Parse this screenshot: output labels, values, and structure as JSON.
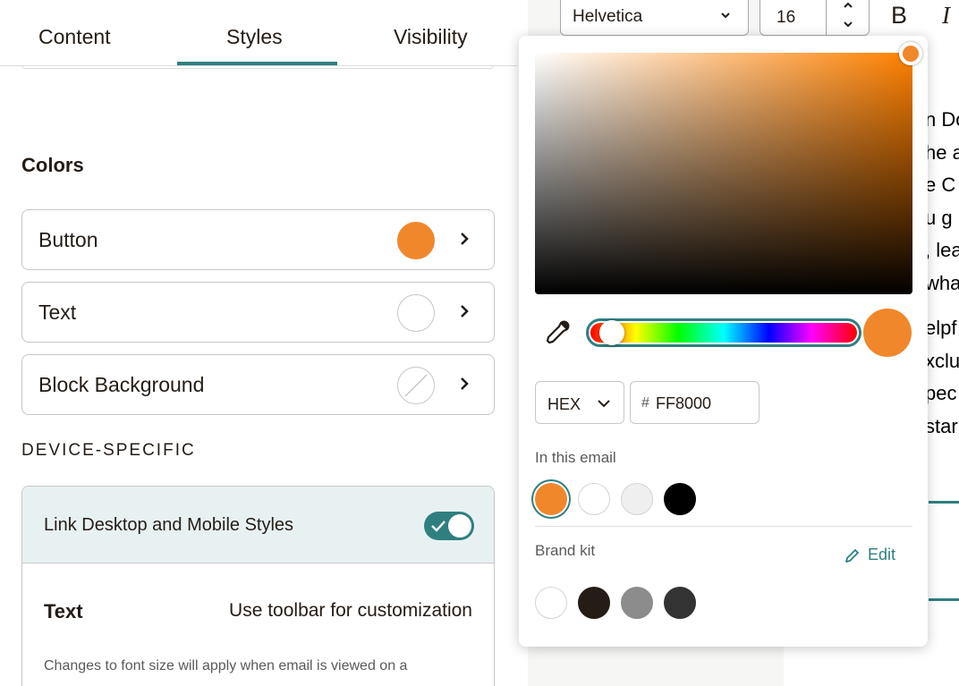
{
  "tabs": [
    {
      "label": "Content"
    },
    {
      "label": "Styles"
    },
    {
      "label": "Visibility"
    }
  ],
  "active_tab": "Styles",
  "colors_section": {
    "title": "Colors",
    "rows": [
      {
        "label": "Button",
        "color": "#f0872b"
      },
      {
        "label": "Text",
        "color": "#ffffff"
      },
      {
        "label": "Block Background",
        "color": "transparent"
      }
    ]
  },
  "device_section": {
    "title": "DEVICE-SPECIFIC",
    "link_label": "Link Desktop and Mobile Styles",
    "link_enabled": true,
    "text_label": "Text",
    "text_hint": "Use toolbar for customization",
    "note": "Changes to font size will apply when email is viewed on a"
  },
  "toolbar": {
    "font_family": "Helvetica",
    "font_size": "16",
    "bold_label": "B",
    "italic_label": "I"
  },
  "editor_text": [
    "n Do",
    "he a",
    "e C",
    "u g",
    ", lea",
    "wha",
    "elpf",
    "xclu",
    "pec",
    "star"
  ],
  "color_picker": {
    "selected_hex": "FF8000",
    "preview_color": "#f0872b",
    "format": "HEX",
    "hash_symbol": "#",
    "in_email_label": "In this email",
    "in_email_swatches": [
      "#f0872b",
      "#ffffff",
      "#efefef",
      "#000000"
    ],
    "brand_kit_label": "Brand kit",
    "edit_label": "Edit",
    "brand_kit_swatches": [
      "#ffffff",
      "#241c15",
      "#8c8c8c",
      "#333333"
    ]
  },
  "accent_color": "#2f7f80"
}
